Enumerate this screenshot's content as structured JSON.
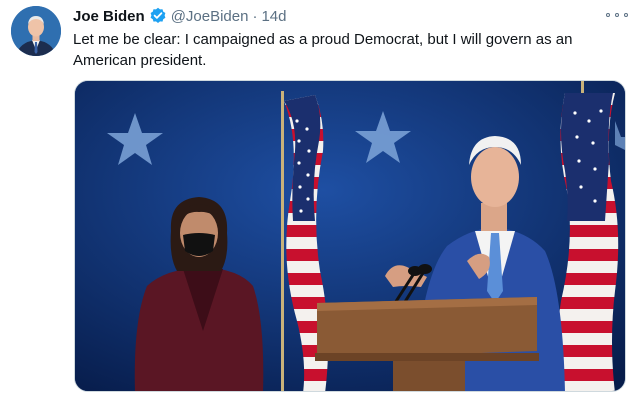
{
  "tweet": {
    "display_name": "Joe Biden",
    "handle": "@JoeBiden",
    "separator": "·",
    "time": "14d",
    "text": "Let me be clear: I campaigned as a proud Democrat, but I will govern as an American president."
  },
  "icons": {
    "verified": "verified-badge-icon",
    "more": "more-options-icon"
  },
  "colors": {
    "verified_blue": "#1da1f2",
    "muted_text": "#5b7083",
    "photo_background": "#0d2f73"
  }
}
